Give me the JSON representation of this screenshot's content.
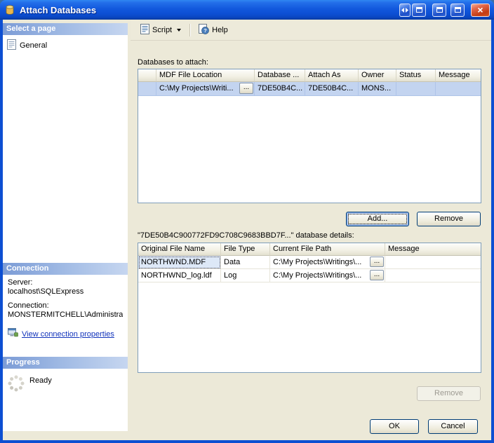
{
  "colors": {
    "titlebar_blue": "#0C52D8",
    "section_header_blue": "#7C9CD6",
    "selection_blue": "#C3D4F0",
    "link_blue": "#1133BB",
    "close_red": "#C33C15"
  },
  "icons": {
    "close_glyph": "×"
  },
  "window": {
    "title": "Attach Databases"
  },
  "sidebar": {
    "select_page": {
      "header": "Select a page",
      "items": [
        {
          "label": "General"
        }
      ]
    },
    "connection": {
      "header": "Connection",
      "server_label": "Server:",
      "server_value": "localhost\\SQLExpress",
      "connection_label": "Connection:",
      "connection_value": "MONSTERMITCHELL\\Administra",
      "link_label": "View connection properties"
    },
    "progress": {
      "header": "Progress",
      "status": "Ready"
    }
  },
  "toolbar": {
    "script_label": "Script",
    "help_label": "Help"
  },
  "main": {
    "attach_label": "Databases to attach:",
    "attach_table": {
      "columns": [
        "",
        "MDF File Location",
        "Database ...",
        "Attach As",
        "Owner",
        "Status",
        "Message"
      ],
      "rows": [
        {
          "mdf_file_location": "C:\\My Projects\\Writi...",
          "browse_label": "...",
          "database": "7DE50B4C...",
          "attach_as": "7DE50B4C...",
          "owner": "MONS...",
          "status": "",
          "message": ""
        }
      ]
    },
    "add_label": "Add...",
    "remove_label": "Remove",
    "details_label": "\"7DE50B4C900772FD9C708C9683BBD7F...\" database details:",
    "details_table": {
      "columns": [
        "Original File Name",
        "File Type",
        "Current File Path",
        "Message"
      ],
      "rows": [
        {
          "original_file_name": "NORTHWND.MDF",
          "file_type": "Data",
          "current_file_path": "C:\\My Projects\\Writings\\...",
          "browse_label": "...",
          "message": ""
        },
        {
          "original_file_name": "NORTHWND_log.ldf",
          "file_type": "Log",
          "current_file_path": "C:\\My Projects\\Writings\\...",
          "browse_label": "...",
          "message": ""
        }
      ]
    },
    "details_remove_label": "Remove",
    "ok_label": "OK",
    "cancel_label": "Cancel"
  }
}
